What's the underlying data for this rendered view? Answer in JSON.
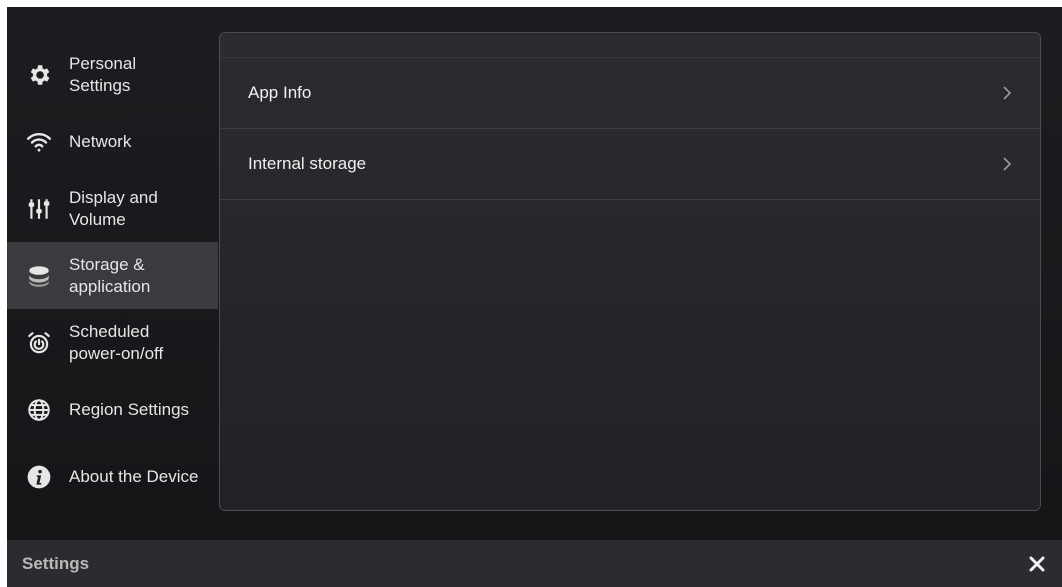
{
  "sidebar": {
    "items": [
      {
        "label": "Personal Settings",
        "icon": "gear-icon",
        "active": false
      },
      {
        "label": "Network",
        "icon": "wifi-icon",
        "active": false
      },
      {
        "label": "Display and Volume",
        "icon": "sliders-icon",
        "active": false
      },
      {
        "label": "Storage & application",
        "icon": "storage-icon",
        "active": true
      },
      {
        "label": "Scheduled power-on/off",
        "icon": "alarm-clock-icon",
        "active": false
      },
      {
        "label": "Region Settings",
        "icon": "globe-icon",
        "active": false
      },
      {
        "label": "About the Device",
        "icon": "info-icon",
        "active": false
      }
    ]
  },
  "main": {
    "rows": [
      {
        "label": "App Info"
      },
      {
        "label": "Internal storage"
      }
    ]
  },
  "bottom_bar": {
    "title": "Settings",
    "close_icon": "close-icon"
  },
  "colors": {
    "background": "#1b1d20",
    "active_item": "#3a3b3e",
    "panel_border": "#4a4c50",
    "bottom_bar": "#2b2c2f",
    "text": "#e6e6e6"
  }
}
